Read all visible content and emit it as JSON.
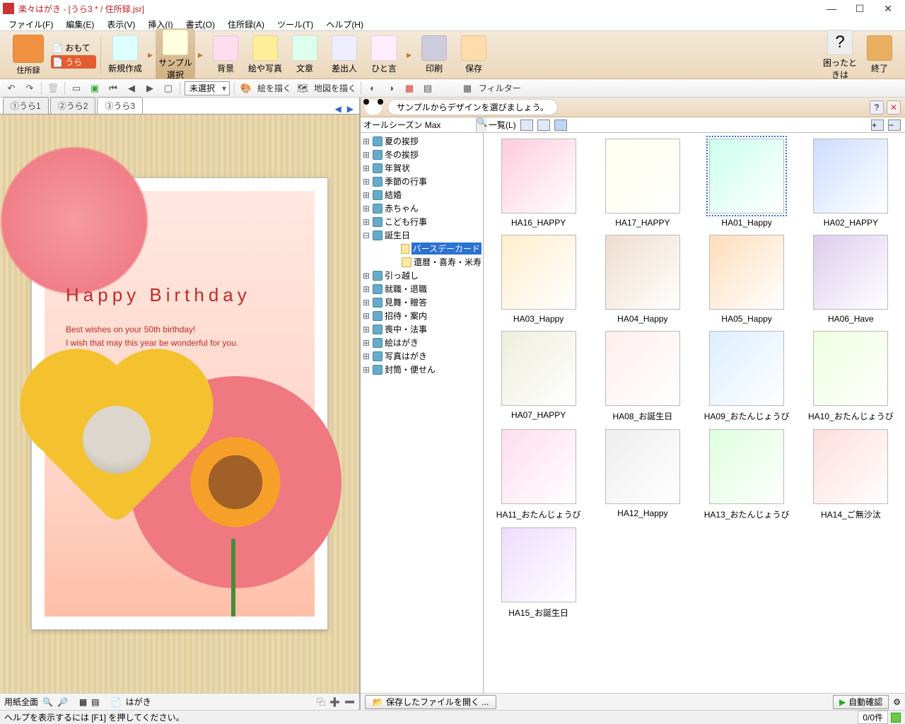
{
  "window": {
    "title": "楽々はがき - [うら3 * / 住所録.jsr]"
  },
  "menus": [
    "ファイル(F)",
    "編集(E)",
    "表示(V)",
    "挿入(I)",
    "書式(O)",
    "住所録(A)",
    "ツール(T)",
    "ヘルプ(H)"
  ],
  "ribbon": {
    "main": "住所録",
    "side_omote": "おもて",
    "side_ura": "うら",
    "items": [
      "新規作成",
      "サンプル選択",
      "背景",
      "絵や写真",
      "文章",
      "差出人",
      "ひと言",
      "印刷",
      "保存"
    ],
    "selected": "サンプル選択",
    "help": "困ったときは",
    "exit": "終了"
  },
  "toolbar2": {
    "unselected": "未選択",
    "draw": "絵を描く",
    "map": "地図を描く",
    "filter": "フィルター"
  },
  "tabs": {
    "items": [
      "①うら1",
      "②うら2",
      "③うら3"
    ],
    "active": 2
  },
  "postcard": {
    "heading": "Happy Birthday",
    "line1": "Best wishes on your 50th birthday!",
    "line2": "I wish that may this year be wonderful for you."
  },
  "left_status": {
    "paper": "用紙全面",
    "type": "はがき"
  },
  "hint": {
    "text": "サンプルからデザインを選びましょう。"
  },
  "tree": {
    "search": "オールシーズン Max",
    "roots": [
      "夏の挨拶",
      "冬の挨拶",
      "年賀状",
      "季節の行事",
      "結婚",
      "赤ちゃん",
      "こども行事"
    ],
    "open_node": "誕生日",
    "children": [
      "バースデーカード",
      "還暦・喜寿・米寿"
    ],
    "selected_child": "バースデーカード",
    "rest": [
      "引っ越し",
      "就職・退職",
      "見舞・贈答",
      "招待・案内",
      "喪中・法事",
      "絵はがき",
      "写真はがき",
      "封筒・便せん"
    ]
  },
  "list": {
    "label": "一覧(L)",
    "items": [
      "HA16_HAPPY",
      "HA17_HAPPY",
      "HA01_Happy",
      "HA02_HAPPY",
      "HA03_Happy",
      "HA04_Happy",
      "HA05_Happy",
      "HA06_Have",
      "HA07_HAPPY",
      "HA08_お誕生日",
      "HA09_おたんじょうび",
      "HA10_おたんじょうび",
      "HA11_おたんじょうび",
      "HA12_Happy",
      "HA13_おたんじょうび",
      "HA14_ご無沙汰",
      "HA15_お誕生日"
    ],
    "selected": "HA01_Happy"
  },
  "right_status": {
    "open": "保存したファイルを開く ...",
    "auto": "自動確認"
  },
  "status": {
    "help": "ヘルプを表示するには [F1] を押してください。",
    "count": "0/0件"
  }
}
